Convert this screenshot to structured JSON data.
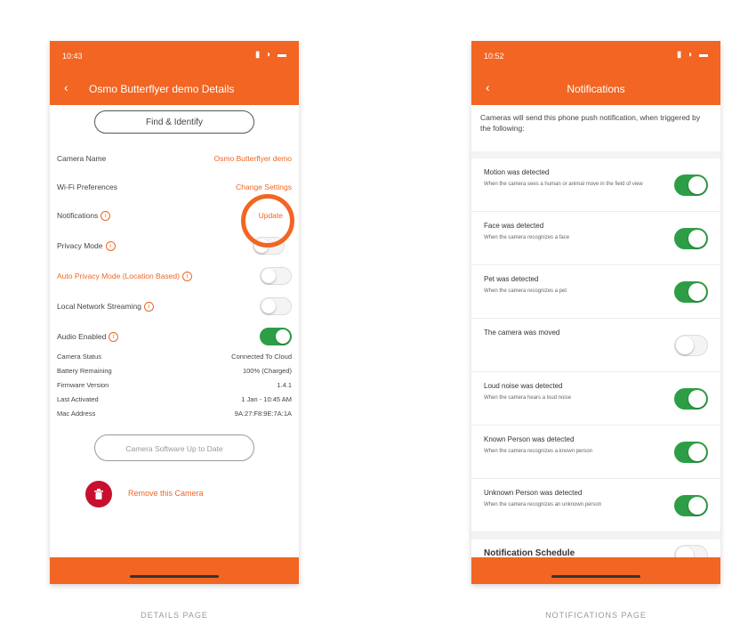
{
  "details": {
    "status_time": "10:43",
    "status_icons": "▮ ◗ ▬",
    "nav_title": "Osmo Butterflyer demo Details",
    "find_button": "Find & Identify",
    "rows": [
      {
        "label": "Camera Name",
        "value": "Osmo Butterflyer demo"
      },
      {
        "label": "Wi-Fi Preferences",
        "value": "Change Settings"
      },
      {
        "label": "Notifications",
        "value": "Update"
      }
    ],
    "toggles": [
      {
        "label": "Privacy Mode",
        "on": false
      },
      {
        "label": "Auto Privacy Mode (Location Based)",
        "on": false
      },
      {
        "label": "Local Network Streaming",
        "on": false
      },
      {
        "label": "Audio Enabled",
        "on": true
      }
    ],
    "status": [
      {
        "label": "Camera Status",
        "value": "Connected To Cloud"
      },
      {
        "label": "Battery Remaining",
        "value": "100% (Charged)"
      },
      {
        "label": "Firmware Version",
        "value": "1.4.1"
      },
      {
        "label": "Last Activated",
        "value": "1 Jan - 10:45 AM"
      },
      {
        "label": "Mac Address",
        "value": "9A:27:F8:9E:7A:1A"
      }
    ],
    "update_button": "Camera Software Up to Date",
    "remove_label": "Remove this Camera",
    "caption": "DETAILS PAGE"
  },
  "notifications": {
    "status_time": "10:52",
    "status_icons": "▮ ◗ ▬",
    "nav_title": "Notifications",
    "intro": "Cameras will send this phone push notification, when triggered by the following:",
    "items": [
      {
        "title": "Motion was detected",
        "desc": "When the camera sees a human or animal move in the field of view",
        "on": true
      },
      {
        "title": "Face was detected",
        "desc": "When the camera recognizes a face",
        "on": true
      },
      {
        "title": "Pet was detected",
        "desc": "When the camera recognizes a pet",
        "on": true
      },
      {
        "title": "The camera was moved",
        "desc": "",
        "on": false
      },
      {
        "title": "Loud noise was detected",
        "desc": "When the camera hears a loud noise",
        "on": true
      },
      {
        "title": "Known Person was detected",
        "desc": "When the camera recognizes a known person",
        "on": true
      },
      {
        "title": "Unknown Person was detected",
        "desc": "When the camera recognizes an unknown person",
        "on": true
      }
    ],
    "schedule_label": "Notification Schedule",
    "caption": "NOTIFICATIONS PAGE"
  },
  "colors": {
    "accent": "#f26522",
    "toggle_on": "#2e9e46",
    "danger": "#c8102e"
  }
}
